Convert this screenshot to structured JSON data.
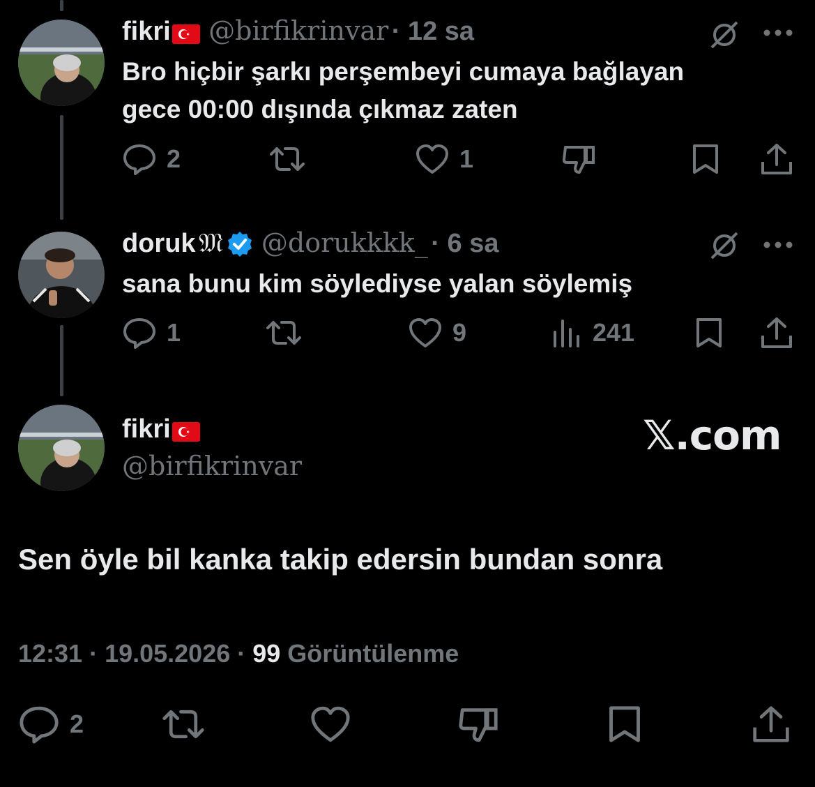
{
  "tweets": [
    {
      "display_name": "fikri",
      "flag": "🇹🇷",
      "handle": "@birfikrinvar",
      "time": "· 12 sa",
      "text_line1": "Bro hiçbir şarkı perşembeyi cumaya bağlayan",
      "text_line2": "gece 00:00 dışında  çıkmaz zaten",
      "replies": "2",
      "likes": "1",
      "icons": [
        "grok-icon",
        "more-icon",
        "reply-icon",
        "retweet-icon",
        "like-icon",
        "dislike-icon",
        "bookmark-icon",
        "share-icon"
      ]
    },
    {
      "display_name": "doruk",
      "badge_glyph": "𝔐",
      "handle": "@dorukkkk_",
      "time": "· 6 sa",
      "text": "sana bunu kim söylediyse yalan söylemiş",
      "replies": "1",
      "likes": "9",
      "views": "241",
      "verified_color": "#1d9bf0",
      "icons": [
        "grok-icon",
        "more-icon",
        "reply-icon",
        "retweet-icon",
        "like-icon",
        "views-icon",
        "bookmark-icon",
        "share-icon"
      ]
    }
  ],
  "main_tweet": {
    "display_name": "fikri",
    "flag": "🇹🇷",
    "handle": "@birfikrinvar",
    "watermark": "𝕏.com",
    "text": "Sen öyle bil kanka takip edersin bundan sonra",
    "timestamp": "12:31 · 19.05.2026 · ",
    "view_count": "99",
    "view_label": " Görüntülenme",
    "replies": "2",
    "icons": [
      "reply-icon",
      "retweet-icon",
      "like-icon",
      "dislike-icon",
      "bookmark-icon",
      "share-icon"
    ]
  },
  "colors": {
    "background": "#000000",
    "text": "#e7e9ea",
    "muted": "#71767b",
    "verified": "#1d9bf0",
    "thread_line": "#3e4144"
  }
}
